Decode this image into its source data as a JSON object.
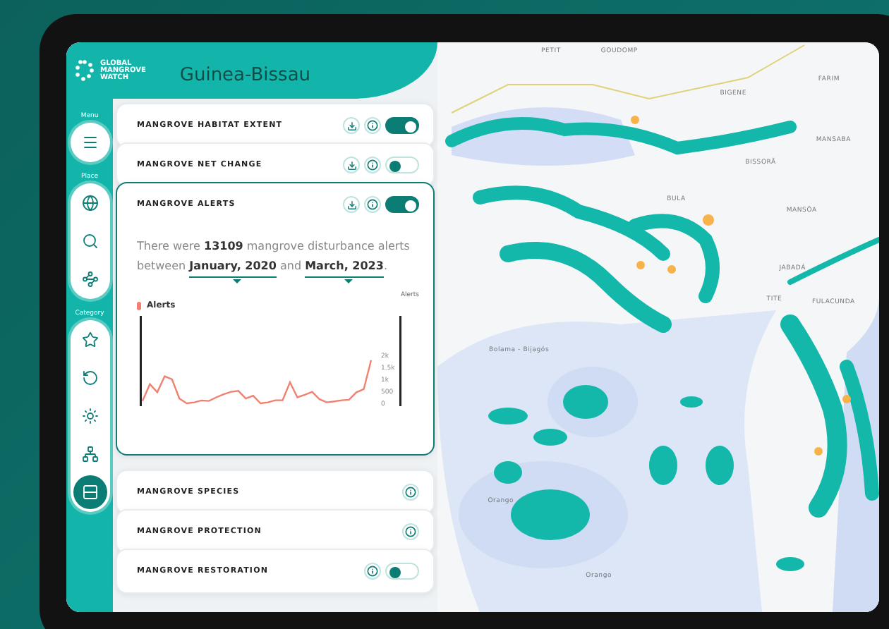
{
  "app": {
    "logo_text": [
      "GLOBAL",
      "MANGROVE",
      "WATCH"
    ],
    "title": "Guinea-Bissau"
  },
  "sidebar": {
    "groups": [
      {
        "label": "Menu",
        "items": [
          {
            "selected": false
          }
        ]
      },
      {
        "label": "Place",
        "items": [
          {
            "selected": false
          },
          {
            "selected": false
          },
          {
            "selected": false
          }
        ]
      },
      {
        "label": "Category",
        "items": [
          {
            "selected": false
          },
          {
            "selected": false
          },
          {
            "selected": false
          },
          {
            "selected": false
          },
          {
            "selected": true
          }
        ]
      }
    ]
  },
  "layers": [
    {
      "title": "MANGROVE HABITAT EXTENT",
      "download": true,
      "info": true,
      "toggle": {
        "on": true
      },
      "expanded": false
    },
    {
      "title": "MANGROVE NET CHANGE",
      "download": true,
      "info": true,
      "toggle": {
        "on": false
      },
      "expanded": false
    },
    {
      "title": "MANGROVE ALERTS",
      "download": true,
      "info": true,
      "toggle": {
        "on": true
      },
      "expanded": true,
      "summary": {
        "before": "There were **13109** mangrove disturbance alerts between",
        "start": "January, 2020",
        "middle": "and",
        "end": "March, 2023",
        "after": "."
      },
      "chart_data": {
        "type": "line",
        "categories": [
          null,
          null,
          null,
          null,
          null,
          null,
          null,
          null,
          null,
          null,
          null,
          null,
          null,
          null,
          null,
          null,
          null,
          null,
          null,
          null,
          null,
          null,
          null,
          null,
          null,
          null,
          null,
          null,
          null,
          null,
          null,
          null
        ],
        "ylabel": "Alerts",
        "ylim": [
          0,
          2000
        ],
        "yticks": [
          {
            "value": 0,
            "label": "0"
          },
          {
            "value": 500,
            "label": "500"
          },
          {
            "value": 1000,
            "label": "1k"
          },
          {
            "value": 1500,
            "label": "1.5k"
          },
          {
            "value": 2000,
            "label": "2k"
          }
        ],
        "series": [
          {
            "name": "Alerts",
            "color": "#f08070",
            "values": [
              100,
              800,
              460,
              1130,
              1000,
              200,
              0,
              40,
              120,
              100,
              250,
              380,
              480,
              520,
              200,
              320,
              0,
              40,
              130,
              130,
              880,
              250,
              360,
              480,
              170,
              40,
              80,
              130,
              150,
              460,
              590,
              1800
            ]
          }
        ]
      }
    },
    {
      "title": "MANGROVE SPECIES",
      "download": false,
      "info": true,
      "expanded": false
    },
    {
      "title": "MANGROVE PROTECTION",
      "download": false,
      "info": true,
      "expanded": false
    },
    {
      "title": "MANGROVE RESTORATION",
      "download": false,
      "info": true,
      "toggle": {
        "on": false
      },
      "expanded": false
    }
  ],
  "map": {
    "labels": [
      "PETIT",
      "GOUDOMP",
      "BIGENE",
      "FARIM",
      "MANSABA",
      "BISSORÃ",
      "BULA",
      "MANSÔA",
      "JABADÁ",
      "TITE",
      "FULACUNDA",
      "Bolama - Bijagós",
      "Orango",
      "Orango"
    ]
  }
}
